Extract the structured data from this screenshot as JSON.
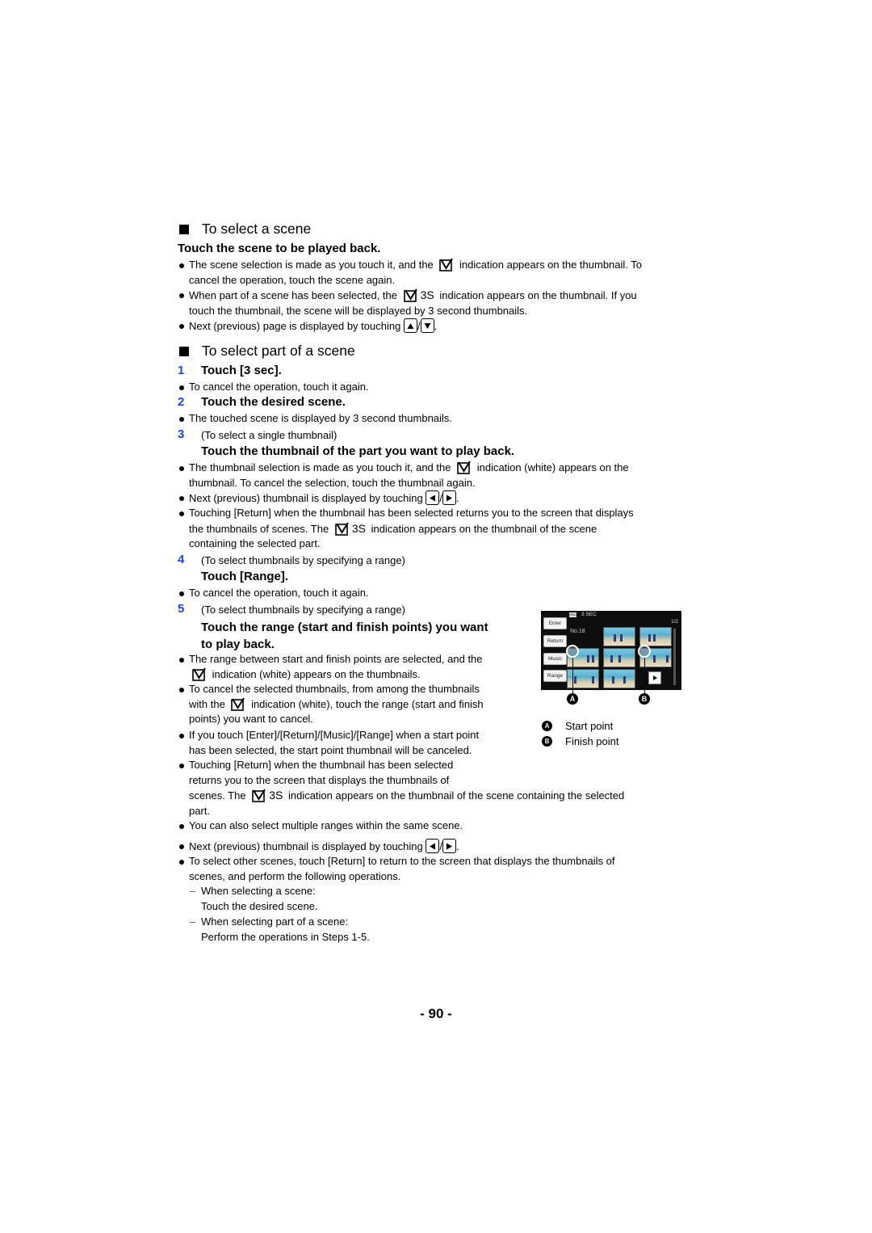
{
  "section1": {
    "heading": "To select a scene",
    "subheading": "Touch the scene to be played back.",
    "bullets": [
      {
        "pre": "The scene selection is made as you touch it, and the",
        "post": "indication appears on the thumbnail. To",
        "line2": "cancel the operation, touch the scene again."
      },
      {
        "pre": "When part of a scene has been selected, the",
        "badge": "3S",
        "post": "indication appears on the thumbnail. If you",
        "line2": "touch the thumbnail, the scene will be displayed by 3 second thumbnails."
      },
      {
        "pre": "Next (previous) page is displayed by touching",
        "sep": "/",
        "end": "."
      }
    ]
  },
  "section2": {
    "heading": "To select part of a scene",
    "steps": [
      {
        "num": "1",
        "title": "Touch [3 sec].",
        "bullets": [
          "To cancel the operation, touch it again."
        ]
      },
      {
        "num": "2",
        "title": "Touch the desired scene.",
        "bullets": [
          "The touched scene is displayed by 3 second thumbnails."
        ]
      },
      {
        "num": "3",
        "note": "(To select a single thumbnail)",
        "title": "Touch the thumbnail of the part you want to play back.",
        "bullets": [
          {
            "pre": "The thumbnail selection is made as you touch it, and the",
            "post": "indication (white) appears on the",
            "line2": "thumbnail. To cancel the selection, touch the thumbnail again."
          },
          {
            "pre": "Next (previous) thumbnail is displayed by touching",
            "sep": "/",
            "end": "."
          },
          {
            "line1": "Touching [Return] when the thumbnail has been selected returns you to the screen that displays",
            "pre": "the thumbnails of scenes. The",
            "badge": "3S",
            "post": "indication appears on the thumbnail of the scene",
            "line3": "containing the selected part."
          }
        ]
      },
      {
        "num": "4",
        "note": "(To select thumbnails by specifying a range)",
        "title": "Touch [Range].",
        "bullets": [
          "To cancel the operation, touch it again."
        ]
      },
      {
        "num": "5",
        "note": "(To select thumbnails by specifying a range)",
        "title_line1": "Touch the range (start and finish points) you want",
        "title_line2": "to play back.",
        "bullets": [
          {
            "line1": "The range between start and finish points are selected, and the",
            "post": "indication (white) appears on the thumbnails."
          },
          {
            "line1": "To cancel the selected thumbnails, from among the thumbnails",
            "pre": "with the",
            "post": "indication (white), touch the range (start and finish",
            "line3": "points) you want to cancel."
          },
          {
            "line1": "If you touch [Enter]/[Return]/[Music]/[Range] when a start point",
            "line2": "has been selected, the start point thumbnail will be canceled."
          },
          {
            "line1": "Touching [Return] when the thumbnail has been selected",
            "line2": "returns you to the screen that displays the thumbnails of",
            "pre": "scenes. The",
            "badge": "3S",
            "post": "indication appears on the thumbnail of the scene containing the selected",
            "line4": "part."
          },
          {
            "line1": "You can also select multiple ranges within the same scene."
          },
          {
            "pre": "Next (previous) thumbnail is displayed by touching",
            "sep": "/",
            "end": "."
          },
          {
            "line1": "To select other scenes, touch [Return] to return to the screen that displays the thumbnails of",
            "line2": "scenes, and perform the following operations.",
            "subs": [
              {
                "dash": "–",
                "a": "When selecting a scene:",
                "b": "Touch the desired scene."
              },
              {
                "dash": "–",
                "a": "When selecting part of a scene:",
                "b": "Perform the operations in Steps 1-5."
              }
            ]
          }
        ]
      }
    ]
  },
  "figure": {
    "screen": {
      "mode_icon": "MNU",
      "mode_label": "3 SEC",
      "page": "1/2",
      "scene_no": "No.18",
      "buttons": [
        "Enter",
        "Return",
        "Music",
        "Range"
      ]
    },
    "legend": [
      {
        "mark": "A",
        "label": "Start point"
      },
      {
        "mark": "B",
        "label": "Finish point"
      }
    ]
  },
  "page_number": "- 90 -",
  "colors": {
    "step_number": "#1f47d6"
  }
}
